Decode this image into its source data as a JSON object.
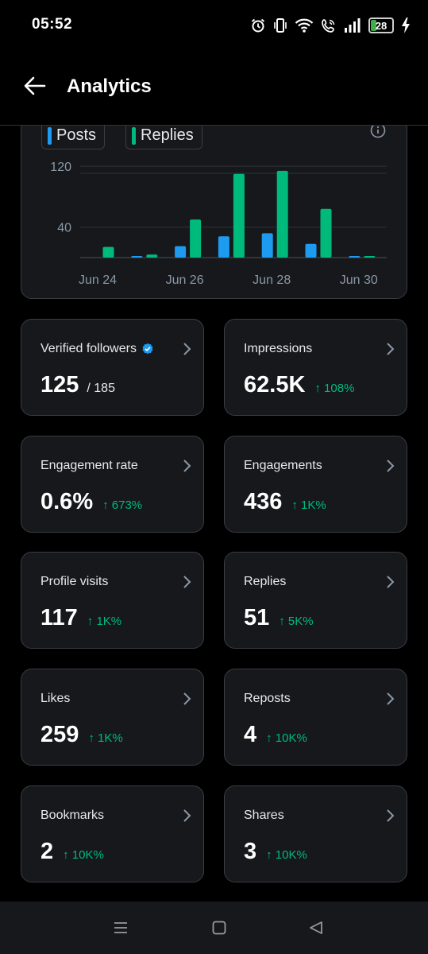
{
  "status_bar": {
    "time": "05:52",
    "battery_level": "28",
    "battery_fraction": 0.28,
    "icons": [
      "alarm-icon",
      "vibrate-icon",
      "wifi-icon",
      "wifi-call-icon",
      "signal-icon",
      "battery-icon",
      "charging-icon"
    ]
  },
  "header": {
    "title": "Analytics",
    "back_icon": "arrow-left-icon"
  },
  "chart": {
    "legend": [
      {
        "label": "Posts",
        "color": "#1d9bf0"
      },
      {
        "label": "Replies",
        "color": "#00ba7c"
      }
    ],
    "info_icon": "info-icon"
  },
  "chart_data": {
    "type": "bar",
    "categories": [
      "Jun 24",
      "Jun 25",
      "Jun 26",
      "Jun 27",
      "Jun 28",
      "Jun 29",
      "Jun 30"
    ],
    "x_tick_labels": [
      "Jun 24",
      "Jun 26",
      "Jun 28",
      "Jun 30"
    ],
    "y_tick_labels": [
      "40",
      "120"
    ],
    "ylim": [
      0,
      140
    ],
    "series": [
      {
        "name": "Posts",
        "color": "#1d9bf0",
        "values": [
          0,
          2,
          15,
          28,
          32,
          18,
          1
        ]
      },
      {
        "name": "Replies",
        "color": "#00ba7c",
        "values": [
          14,
          4,
          50,
          110,
          114,
          64,
          2
        ]
      }
    ],
    "grid": true,
    "legend_position": "top-left"
  },
  "stats": [
    {
      "label": "Verified followers",
      "value": "125",
      "sub": "/ 185",
      "change": "",
      "verified_icon": true
    },
    {
      "label": "Impressions",
      "value": "62.5K",
      "change": "↑ 108%"
    },
    {
      "label": "Engagement rate",
      "value": "0.6%",
      "change": "↑ 673%"
    },
    {
      "label": "Engagements",
      "value": "436",
      "change": "↑ 1K%"
    },
    {
      "label": "Profile visits",
      "value": "117",
      "change": "↑ 1K%"
    },
    {
      "label": "Replies",
      "value": "51",
      "change": "↑ 5K%"
    },
    {
      "label": "Likes",
      "value": "259",
      "change": "↑ 1K%"
    },
    {
      "label": "Reposts",
      "value": "4",
      "change": "↑ 10K%"
    },
    {
      "label": "Bookmarks",
      "value": "2",
      "change": "↑ 10K%"
    },
    {
      "label": "Shares",
      "value": "3",
      "change": "↑ 10K%"
    }
  ],
  "colors": {
    "background": "#000000",
    "card": "#16181c",
    "accent_blue": "#1d9bf0",
    "accent_green": "#00ba7c"
  },
  "nav": {
    "icons": [
      "recent-apps-icon",
      "home-icon",
      "back-icon"
    ]
  }
}
